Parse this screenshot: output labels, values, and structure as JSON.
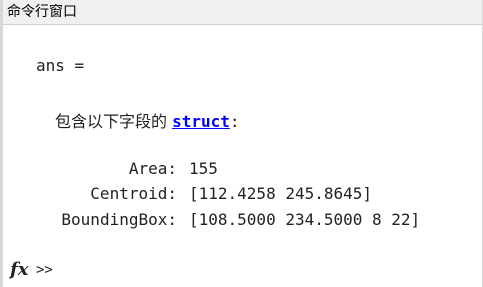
{
  "window": {
    "title": "命令行窗口"
  },
  "output": {
    "ans_line": "ans =",
    "struct_desc": "包含以下字段的 ",
    "struct_link": "struct",
    "struct_colon": ":",
    "fields": [
      {
        "name": "Area:",
        "value": "155"
      },
      {
        "name": "Centroid:",
        "value": "[112.4258 245.8645]"
      },
      {
        "name": "BoundingBox:",
        "value": "[108.5000 234.5000 8 22]"
      }
    ]
  },
  "prompt": {
    "icon_text": "fx",
    "symbol": ">>",
    "value": ""
  }
}
